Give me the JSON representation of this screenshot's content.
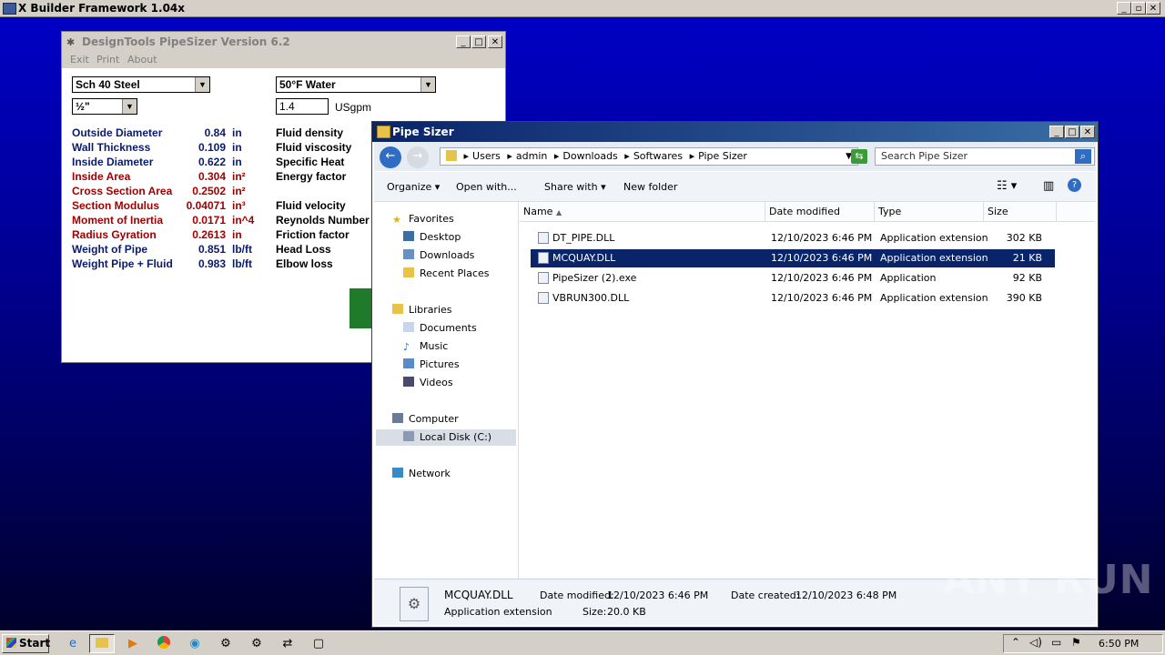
{
  "desktop": {
    "app_title": "X Builder Framework 1.04x",
    "watermark": "ANY RUN"
  },
  "pipesizer": {
    "title": "DesignTools PipeSizer Version 6.2",
    "menu": [
      "Exit",
      "Print",
      "About"
    ],
    "pipe_type": "Sch 40 Steel",
    "pipe_size": "½\"",
    "fluid": "50°F Water",
    "flow_value": "1.4",
    "flow_unit": "USgpm",
    "properties": [
      {
        "label": "Outside Diameter",
        "value": "0.84",
        "unit": "in",
        "color": "navy"
      },
      {
        "label": "Wall Thickness",
        "value": "0.109",
        "unit": "in",
        "color": "navy"
      },
      {
        "label": "Inside Diameter",
        "value": "0.622",
        "unit": "in",
        "color": "navy"
      },
      {
        "label": "Inside Area",
        "value": "0.304",
        "unit": "in²",
        "color": "red"
      },
      {
        "label": "Cross Section Area",
        "value": "0.2502",
        "unit": "in²",
        "color": "red"
      },
      {
        "label": "Section Modulus",
        "value": "0.04071",
        "unit": "in³",
        "color": "red"
      },
      {
        "label": "Moment of Inertia",
        "value": "0.0171",
        "unit": "in^4",
        "color": "red"
      },
      {
        "label": "Radius Gyration",
        "value": "0.2613",
        "unit": "in",
        "color": "red"
      },
      {
        "label": "Weight of Pipe",
        "value": "0.851",
        "unit": "lb/ft",
        "color": "navy"
      },
      {
        "label": "Weight Pipe + Fluid",
        "value": "0.983",
        "unit": "lb/ft",
        "color": "navy"
      }
    ],
    "fluid_properties": [
      "Fluid density",
      "Fluid viscosity",
      "Specific Heat",
      "Energy factor",
      "",
      "Fluid velocity",
      "Reynolds Number",
      "Friction factor",
      "Head Loss",
      "Elbow loss"
    ]
  },
  "explorer": {
    "title": "Pipe Sizer",
    "breadcrumb": [
      "Users",
      "admin",
      "Downloads",
      "Softwares",
      "Pipe Sizer"
    ],
    "search_placeholder": "Search Pipe Sizer",
    "toolbar": {
      "organize": "Organize",
      "open_with": "Open with...",
      "share_with": "Share with",
      "new_folder": "New folder"
    },
    "nav": {
      "favorites": "Favorites",
      "favorites_items": [
        "Desktop",
        "Downloads",
        "Recent Places"
      ],
      "libraries": "Libraries",
      "libraries_items": [
        "Documents",
        "Music",
        "Pictures",
        "Videos"
      ],
      "computer": "Computer",
      "computer_items": [
        "Local Disk (C:)"
      ],
      "network": "Network"
    },
    "columns": {
      "name": "Name",
      "date": "Date modified",
      "type": "Type",
      "size": "Size"
    },
    "files": [
      {
        "name": "DT_PIPE.DLL",
        "date": "12/10/2023 6:46 PM",
        "type": "Application extension",
        "size": "302 KB"
      },
      {
        "name": "MCQUAY.DLL",
        "date": "12/10/2023 6:46 PM",
        "type": "Application extension",
        "size": "21 KB"
      },
      {
        "name": "PipeSizer (2).exe",
        "date": "12/10/2023 6:46 PM",
        "type": "Application",
        "size": "92 KB"
      },
      {
        "name": "VBRUN300.DLL",
        "date": "12/10/2023 6:46 PM",
        "type": "Application extension",
        "size": "390 KB"
      }
    ],
    "details": {
      "name": "MCQUAY.DLL",
      "type": "Application extension",
      "date_modified_label": "Date modified:",
      "date_modified": "12/10/2023 6:46 PM",
      "date_created_label": "Date created:",
      "date_created": "12/10/2023 6:48 PM",
      "size_label": "Size:",
      "size": "20.0 KB"
    }
  },
  "taskbar": {
    "start": "Start",
    "clock": "6:50 PM"
  }
}
